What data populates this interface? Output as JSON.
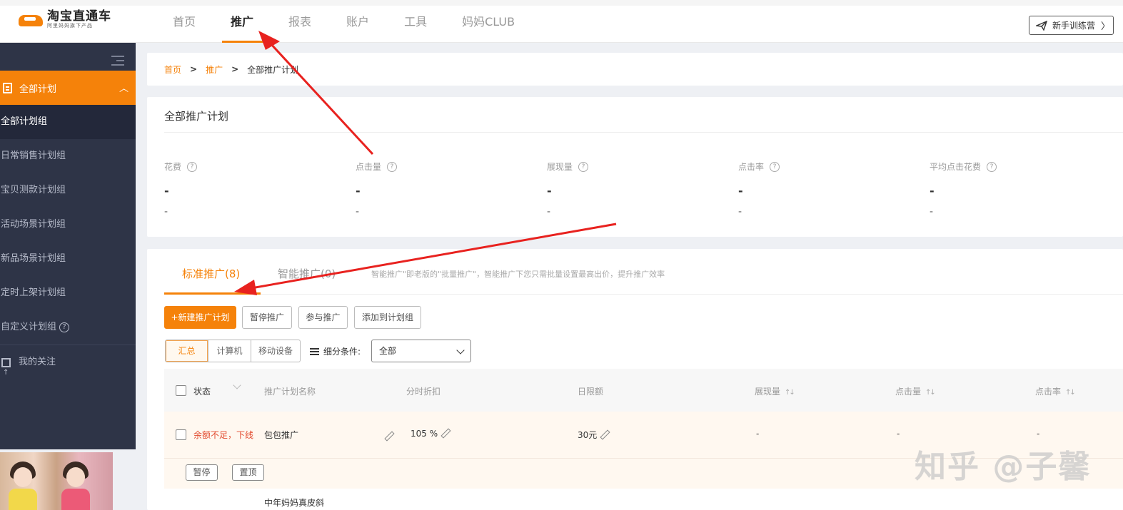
{
  "logo": {
    "main": "淘宝直通车",
    "sub": "阿里妈妈旗下产品"
  },
  "nav": {
    "items": [
      {
        "label": "首页",
        "active": false
      },
      {
        "label": "推广",
        "active": true
      },
      {
        "label": "报表",
        "active": false
      },
      {
        "label": "账户",
        "active": false
      },
      {
        "label": "工具",
        "active": false
      },
      {
        "label": "妈妈CLUB",
        "active": false
      }
    ]
  },
  "trainer_button": {
    "label": "新手训练营",
    "chevron": "〉"
  },
  "sidebar": {
    "header": "全部计划",
    "items": [
      "全部计划组",
      "日常销售计划组",
      "宝贝测款计划组",
      "活动场景计划组",
      "新品场景计划组",
      "定时上架计划组",
      "自定义计划组"
    ],
    "help": "?",
    "follow": "我的关注"
  },
  "breadcrumb": {
    "home": "首页",
    "promo": "推广",
    "current": "全部推广计划"
  },
  "overview": {
    "title": "全部推广计划",
    "metrics": [
      {
        "label": "花费",
        "value": "-",
        "sub": "-"
      },
      {
        "label": "点击量",
        "value": "-",
        "sub": "-"
      },
      {
        "label": "展现量",
        "value": "-",
        "sub": "-"
      },
      {
        "label": "点击率",
        "value": "-",
        "sub": "-"
      },
      {
        "label": "平均点击花费",
        "value": "-",
        "sub": "-"
      }
    ]
  },
  "plans": {
    "tabs": [
      "标准推广(8)",
      "智能推广(0)"
    ],
    "hint": "智能推广\"即老版的\"批量推广\"，智能推广下您只需批量设置最高出价，提升推广效率",
    "buttons": {
      "new": "+新建推广计划",
      "pause": "暂停推广",
      "join": "参与推广",
      "add": "添加到计划组"
    },
    "device_tabs": [
      "汇总",
      "计算机",
      "移动设备"
    ],
    "filter_label": "细分条件:",
    "filter_value": "全部",
    "columns": {
      "status": "状态",
      "name": "推广计划名称",
      "discount": "分时折扣",
      "limit": "日限额",
      "impressions": "展现量",
      "clicks": "点击量",
      "ctr": "点击率",
      "sort": "↑↓"
    },
    "rows": [
      {
        "status": "余额不足，下线",
        "name": "包包推广",
        "discount": "105 %",
        "limit": "30元",
        "impressions": "-",
        "clicks": "-",
        "ctr": "-",
        "action1": "暂停",
        "action2": "置顶"
      },
      {
        "name": "中年妈妈真皮斜"
      }
    ]
  },
  "watermark": "知乎 @子馨",
  "colors": {
    "accent": "#f5820a",
    "sidebar": "#2e3447",
    "arrow": "#e8221f",
    "status_red": "#e24a2e"
  }
}
